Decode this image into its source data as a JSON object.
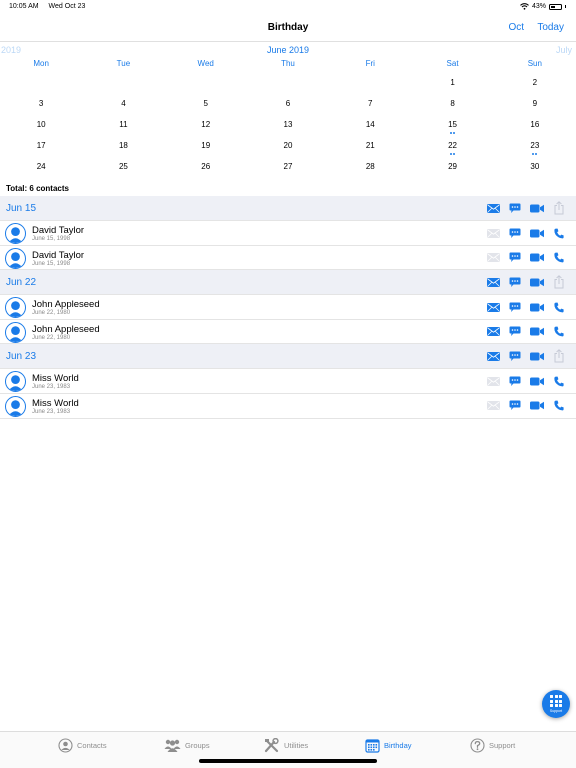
{
  "status_bar": {
    "time": "10:05 AM",
    "date": "Wed Oct 23",
    "battery": "43%",
    "battery_level": 0.43
  },
  "nav": {
    "title": "Birthday",
    "month_button": "Oct",
    "today_button": "Today"
  },
  "calendar": {
    "prev_label": "2019",
    "current_label": "June 2019",
    "next_label": "July",
    "weekdays": [
      "Mon",
      "Tue",
      "Wed",
      "Thu",
      "Fri",
      "Sat",
      "Sun"
    ],
    "weeks": [
      [
        "",
        "",
        "",
        "",
        "",
        "1",
        "2"
      ],
      [
        "3",
        "4",
        "5",
        "6",
        "7",
        "8",
        "9"
      ],
      [
        "10",
        "11",
        "12",
        "13",
        "14",
        "15",
        "16"
      ],
      [
        "17",
        "18",
        "19",
        "20",
        "21",
        "22",
        "23"
      ],
      [
        "24",
        "25",
        "26",
        "27",
        "28",
        "29",
        "30"
      ]
    ],
    "marked_days": {
      "15": 2,
      "22": 2,
      "23": 2
    }
  },
  "total": "Total: 6 contacts",
  "groups": [
    {
      "date": "Jun 15",
      "contacts": [
        {
          "name": "David Taylor",
          "birthday": "June 15, 1998",
          "email_enabled": false
        },
        {
          "name": "David Taylor",
          "birthday": "June 15, 1998",
          "email_enabled": false
        }
      ]
    },
    {
      "date": "Jun 22",
      "contacts": [
        {
          "name": "John Appleseed",
          "birthday": "June 22, 1980",
          "email_enabled": true
        },
        {
          "name": "John Appleseed",
          "birthday": "June 22, 1980",
          "email_enabled": true
        }
      ]
    },
    {
      "date": "Jun 23",
      "contacts": [
        {
          "name": "Miss World",
          "birthday": "June 23, 1983",
          "email_enabled": false
        },
        {
          "name": "Miss World",
          "birthday": "June 23, 1983",
          "email_enabled": false
        }
      ]
    }
  ],
  "fab": {
    "label": "Support",
    "icon": "grid-icon"
  },
  "tabs": [
    {
      "label": "Contacts",
      "icon": "person-circle-icon",
      "active": false
    },
    {
      "label": "Groups",
      "icon": "group-icon",
      "active": false
    },
    {
      "label": "Utilities",
      "icon": "tools-icon",
      "active": false
    },
    {
      "label": "Birthday",
      "icon": "calendar-icon",
      "active": true
    },
    {
      "label": "Support",
      "icon": "question-icon",
      "active": false
    }
  ],
  "colors": {
    "accent": "#1a7be8",
    "header_bg": "#eef0f6",
    "disabled": "#e2e4ea",
    "inactive_tab": "#8e8e8e"
  }
}
